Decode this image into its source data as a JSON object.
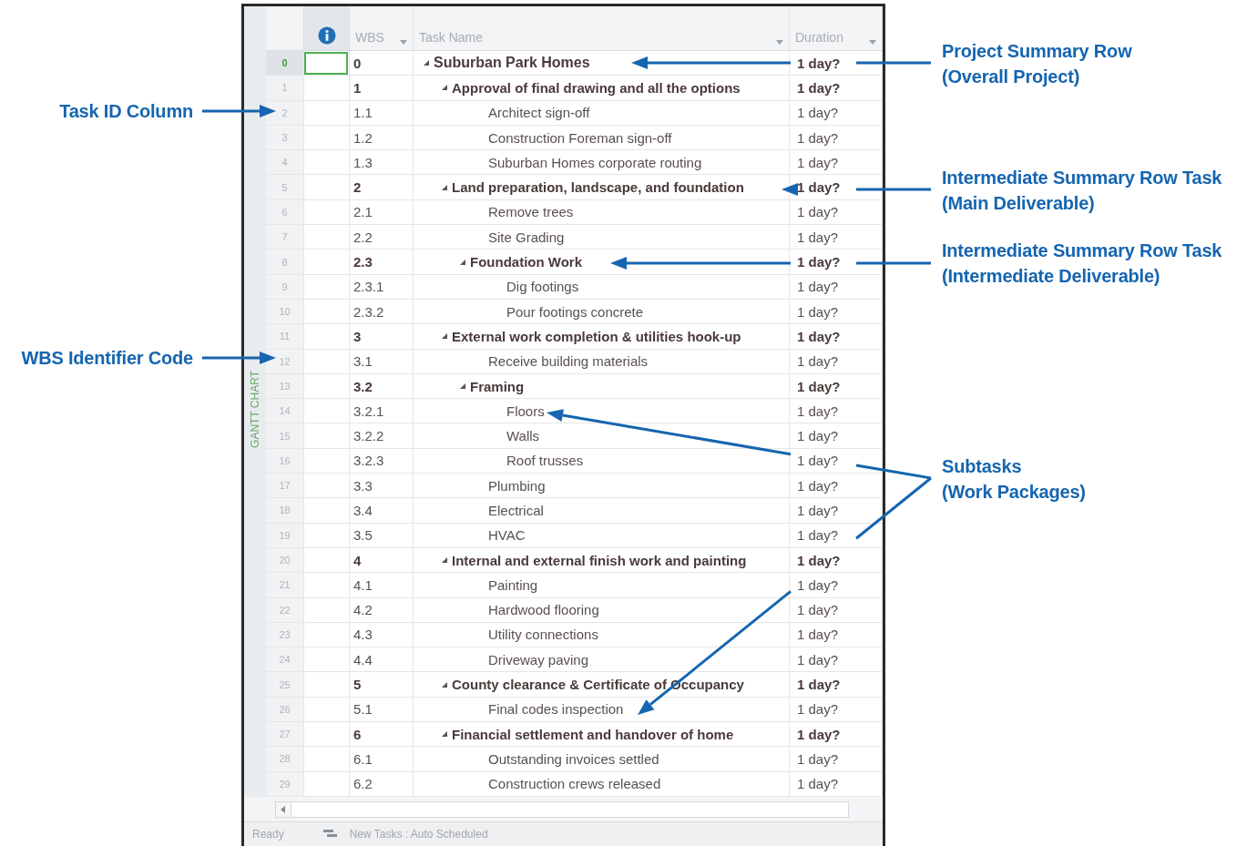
{
  "window": {
    "side_label": "GANTT CHART",
    "columns": {
      "wbs": "WBS",
      "task_name": "Task Name",
      "duration": "Duration"
    },
    "tasks": [
      {
        "id": "0",
        "wbs": "0",
        "name": "Suburban Park Homes",
        "duration": "1 day?",
        "selected": true,
        "expanded": true,
        "children": [
          {
            "id": "1",
            "wbs": "1",
            "name": "Approval of final drawing and all the options",
            "duration": "1 day?",
            "selected": false,
            "expanded": true,
            "children": [
              {
                "id": "2",
                "wbs": "1.1",
                "name": "Architect sign-off",
                "duration": "1 day?",
                "selected": false
              },
              {
                "id": "3",
                "wbs": "1.2",
                "name": "Construction Foreman sign-off",
                "duration": "1 day?",
                "selected": false
              },
              {
                "id": "4",
                "wbs": "1.3",
                "name": "Suburban Homes corporate routing",
                "duration": "1 day?",
                "selected": false
              }
            ]
          },
          {
            "id": "5",
            "wbs": "2",
            "name": "Land preparation, landscape, and foundation",
            "duration": "1 day?",
            "selected": false,
            "expanded": true,
            "children": [
              {
                "id": "6",
                "wbs": "2.1",
                "name": "Remove trees",
                "duration": "1 day?",
                "selected": false
              },
              {
                "id": "7",
                "wbs": "2.2",
                "name": "Site Grading",
                "duration": "1 day?",
                "selected": false
              },
              {
                "id": "8",
                "wbs": "2.3",
                "name": "Foundation Work",
                "duration": "1 day?",
                "selected": false,
                "expanded": true,
                "children": [
                  {
                    "id": "9",
                    "wbs": "2.3.1",
                    "name": "Dig footings",
                    "duration": "1 day?",
                    "selected": false
                  },
                  {
                    "id": "10",
                    "wbs": "2.3.2",
                    "name": "Pour footings concrete",
                    "duration": "1 day?",
                    "selected": false
                  }
                ]
              }
            ]
          },
          {
            "id": "11",
            "wbs": "3",
            "name": "External work completion & utilities hook-up",
            "duration": "1 day?",
            "selected": false,
            "expanded": true,
            "children": [
              {
                "id": "12",
                "wbs": "3.1",
                "name": "Receive building materials",
                "duration": "1 day?",
                "selected": false
              },
              {
                "id": "13",
                "wbs": "3.2",
                "name": "Framing",
                "duration": "1 day?",
                "selected": false,
                "expanded": true,
                "children": [
                  {
                    "id": "14",
                    "wbs": "3.2.1",
                    "name": "Floors",
                    "duration": "1 day?",
                    "selected": false
                  },
                  {
                    "id": "15",
                    "wbs": "3.2.2",
                    "name": "Walls",
                    "duration": "1 day?",
                    "selected": false
                  },
                  {
                    "id": "16",
                    "wbs": "3.2.3",
                    "name": "Roof trusses",
                    "duration": "1 day?",
                    "selected": false
                  }
                ]
              },
              {
                "id": "17",
                "wbs": "3.3",
                "name": "Plumbing",
                "duration": "1 day?",
                "selected": false
              },
              {
                "id": "18",
                "wbs": "3.4",
                "name": "Electrical",
                "duration": "1 day?",
                "selected": false
              },
              {
                "id": "19",
                "wbs": "3.5",
                "name": "HVAC",
                "duration": "1 day?",
                "selected": false
              }
            ]
          },
          {
            "id": "20",
            "wbs": "4",
            "name": "Internal and external finish work and painting",
            "duration": "1 day?",
            "selected": false,
            "expanded": true,
            "children": [
              {
                "id": "21",
                "wbs": "4.1",
                "name": "Painting",
                "duration": "1 day?",
                "selected": false
              },
              {
                "id": "22",
                "wbs": "4.2",
                "name": "Hardwood flooring",
                "duration": "1 day?",
                "selected": false
              },
              {
                "id": "23",
                "wbs": "4.3",
                "name": "Utility connections",
                "duration": "1 day?",
                "selected": false
              },
              {
                "id": "24",
                "wbs": "4.4",
                "name": "Driveway paving",
                "duration": "1 day?",
                "selected": false
              }
            ]
          },
          {
            "id": "25",
            "wbs": "5",
            "name": "County clearance & Certificate of Occupancy",
            "duration": "1 day?",
            "selected": false,
            "expanded": true,
            "children": [
              {
                "id": "26",
                "wbs": "5.1",
                "name": "Final codes inspection",
                "duration": "1 day?",
                "selected": false
              }
            ]
          },
          {
            "id": "27",
            "wbs": "6",
            "name": "Financial settlement and handover of home",
            "duration": "1 day?",
            "selected": false,
            "expanded": true,
            "children": [
              {
                "id": "28",
                "wbs": "6.1",
                "name": "Outstanding invoices settled",
                "duration": "1 day?",
                "selected": false
              },
              {
                "id": "29",
                "wbs": "6.2",
                "name": "Construction crews released",
                "duration": "1 day?",
                "selected": false
              }
            ]
          }
        ]
      }
    ],
    "status_bar": {
      "state": "Ready",
      "mode": "New Tasks : Auto Scheduled"
    }
  },
  "annotations": [
    {
      "title": "Project Summary Row",
      "note": "(Overall Project)"
    },
    {
      "title": "Task ID Column"
    },
    {
      "title": "Intermediate Summary Row Task",
      "note": "(Main Deliverable)"
    },
    {
      "title": "Intermediate Summary Row Task",
      "note": "(Intermediate Deliverable)"
    },
    {
      "title": "WBS Identifier Code"
    },
    {
      "title": "Subtasks",
      "note": "(Work Packages)"
    }
  ]
}
